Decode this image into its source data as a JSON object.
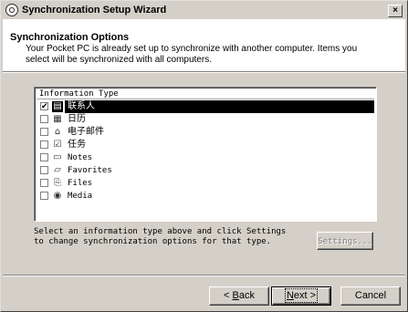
{
  "window": {
    "title": "Synchronization Setup Wizard",
    "close_glyph": "×"
  },
  "header": {
    "title": "Synchronization Options",
    "description": "Your Pocket PC is already set up to synchronize with another computer. Items you select will be synchronized with all computers."
  },
  "list": {
    "column_header": "Information Type",
    "items": [
      {
        "label": "联系人",
        "checked": true,
        "selected": true,
        "icon": "contacts-icon",
        "glyph": "▤"
      },
      {
        "label": "日历",
        "checked": false,
        "selected": false,
        "icon": "calendar-icon",
        "glyph": "▦"
      },
      {
        "label": "电子邮件",
        "checked": false,
        "selected": false,
        "icon": "inbox-icon",
        "glyph": "⌂"
      },
      {
        "label": "任务",
        "checked": false,
        "selected": false,
        "icon": "tasks-icon",
        "glyph": "☑"
      },
      {
        "label": "Notes",
        "checked": false,
        "selected": false,
        "icon": "notes-icon",
        "glyph": "▭"
      },
      {
        "label": "Favorites",
        "checked": false,
        "selected": false,
        "icon": "favorites-folder-icon",
        "glyph": "▱"
      },
      {
        "label": "Files",
        "checked": false,
        "selected": false,
        "icon": "files-icon",
        "glyph": "⎘"
      },
      {
        "label": "Media",
        "checked": false,
        "selected": false,
        "icon": "media-icon",
        "glyph": "◉"
      }
    ]
  },
  "instructions": "Select an information type above and click Settings\nto change synchronization options for that type.",
  "buttons": {
    "settings": "Settings...",
    "back": "< Back",
    "next": "Next >",
    "cancel": "Cancel"
  },
  "checkmark_glyph": "✔"
}
